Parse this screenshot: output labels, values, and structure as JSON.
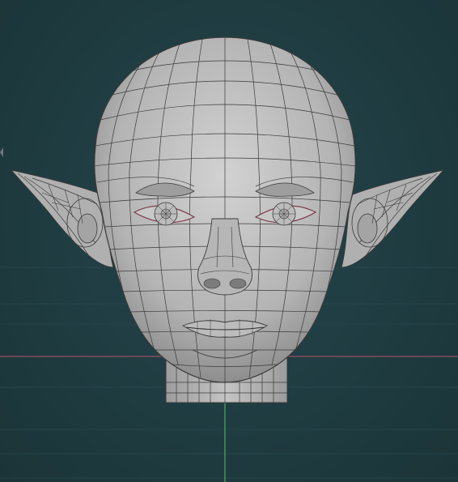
{
  "viewport": {
    "background_color": "#1f3c41",
    "grid_line_color": "#2a4a4f",
    "x_axis_color": "#9a4f5c",
    "y_axis_color": "#4caf50",
    "mesh_fill_color": "#b8b8b8",
    "wire_color": "#3a3a3a"
  },
  "object": {
    "icon": "head-mesh-icon"
  }
}
